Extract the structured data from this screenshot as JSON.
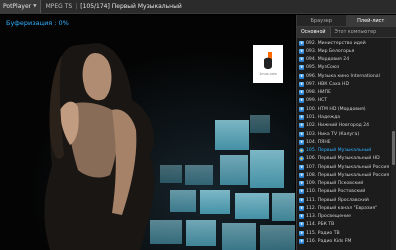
{
  "titlebar": {
    "app_label": "PotPlayer",
    "format": "MPEG TS",
    "channel_title": "[105/174] Первый Музыкальный"
  },
  "video": {
    "buffering_text": "Буферизация : 0%",
    "logo_text": "1mus.com"
  },
  "panel": {
    "tabs": [
      "Браузер",
      "Плей-лист"
    ],
    "active_tab": "Плей-лист",
    "subtabs": [
      "Основной",
      "Этот компьютер"
    ],
    "items": [
      {
        "label": "092. Министерство идей",
        "icon": "play-icon"
      },
      {
        "label": "093. Мир Белогорья",
        "icon": "play-icon"
      },
      {
        "label": "094. Мордовия 24",
        "icon": "play-icon"
      },
      {
        "label": "095. МузСоюз",
        "icon": "play-icon"
      },
      {
        "label": "096. Музыка кино International",
        "icon": "play-icon"
      },
      {
        "label": "097. НВК Саха HD",
        "icon": "play-icon"
      },
      {
        "label": "098. НИПЕ",
        "icon": "play-icon"
      },
      {
        "label": "099. НСТ",
        "icon": "play-icon"
      },
      {
        "label": "100. НТМ HD (Мордовия)",
        "icon": "play-icon"
      },
      {
        "label": "101. Надежда",
        "icon": "play-icon"
      },
      {
        "label": "102. Нижний Новгород 24",
        "icon": "play-icon"
      },
      {
        "label": "103. Ника TV (Калуга)",
        "icon": "play-icon"
      },
      {
        "label": "104. ПЯНЕ",
        "icon": "play-icon"
      },
      {
        "label": "105. Первый Музыкальный",
        "icon": "ie-icon",
        "state": "playing"
      },
      {
        "label": "106. Первый Музыкальный HD",
        "icon": "ie-icon"
      },
      {
        "label": "107. Первый Музыкальный Россия",
        "icon": "play-icon"
      },
      {
        "label": "108. Первый Музыкальный Россия HD",
        "icon": "play-icon"
      },
      {
        "label": "109. Первый Псковский",
        "icon": "play-icon"
      },
      {
        "label": "110. Первый Ростовский",
        "icon": "play-icon"
      },
      {
        "label": "111. Первый Ярославский",
        "icon": "play-icon"
      },
      {
        "label": "112. Первый канал \"Евразия\"",
        "icon": "play-icon"
      },
      {
        "label": "113. Просвещение",
        "icon": "play-icon"
      },
      {
        "label": "114. РБК ТВ",
        "icon": "play-icon"
      },
      {
        "label": "115. Радио ТВ",
        "icon": "play-icon"
      },
      {
        "label": "116. Радио Kids FM",
        "icon": "play-icon"
      }
    ]
  },
  "colors": {
    "accent": "#2fb0ff",
    "panel_bg": "#1c1c1c",
    "selected_bg": "#5e5e5e"
  }
}
